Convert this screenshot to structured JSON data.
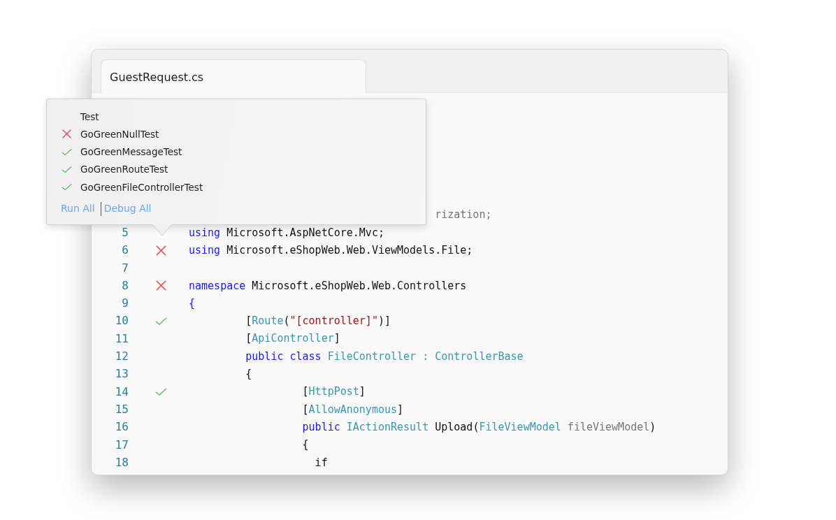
{
  "window": {
    "tab": {
      "label": "GuestRequest.cs",
      "selected": true
    }
  },
  "code_lines": [
    {
      "kind": "cut",
      "tokens": [
        {
          "kind": "comment",
          "text": "rization;"
        }
      ]
    },
    {
      "kind": "top",
      "number": "5",
      "tokens": [
        {
          "kind": "keyword",
          "text": "using"
        },
        {
          "kind": "plain",
          "text": " Microsoft.AspNetCore.Mvc;"
        }
      ]
    },
    {
      "kind": "top",
      "number": "6",
      "test_passed": false,
      "tokens": [
        {
          "kind": "keyword",
          "text": "using"
        },
        {
          "kind": "plain",
          "text": " Microsoft.eShopWeb.Web.ViewModels.File;"
        }
      ]
    },
    {
      "kind": "top",
      "number": "7"
    },
    {
      "kind": "top",
      "number": "8",
      "test_passed": false,
      "tokens": [
        {
          "kind": "keyword",
          "text": "namespace"
        },
        {
          "kind": "plain",
          "text": " Microsoft.eShopWeb.Web.Controllers"
        }
      ]
    },
    {
      "kind": "top",
      "number": "9",
      "tokens": [
        {
          "kind": "keyword",
          "text": "{"
        }
      ]
    },
    {
      "kind": "member",
      "number": "10",
      "test_passed": true,
      "tokens": [
        {
          "kind": "plain",
          "text": "["
        },
        {
          "kind": "type",
          "text": "Route"
        },
        {
          "kind": "plain",
          "text": "("
        },
        {
          "kind": "string",
          "text": "\"[controller]\""
        },
        {
          "kind": "plain",
          "text": ")]"
        }
      ]
    },
    {
      "kind": "member",
      "number": "11",
      "tokens": [
        {
          "kind": "plain",
          "text": "["
        },
        {
          "kind": "type",
          "text": "ApiController"
        },
        {
          "kind": "plain",
          "text": "]"
        }
      ]
    },
    {
      "kind": "member",
      "number": "12",
      "tokens": [
        {
          "kind": "keyword",
          "text": "public class"
        },
        {
          "kind": "type",
          "text": " FileController : ControllerBase"
        }
      ]
    },
    {
      "kind": "member",
      "number": "13",
      "tokens": [
        {
          "kind": "plain",
          "text": "{"
        }
      ]
    },
    {
      "kind": "body",
      "number": "14",
      "test_passed": true,
      "tokens": [
        {
          "kind": "plain",
          "text": "["
        },
        {
          "kind": "type",
          "text": "HttpPost"
        },
        {
          "kind": "plain",
          "text": "]"
        }
      ]
    },
    {
      "kind": "body",
      "number": "15",
      "tokens": [
        {
          "kind": "plain",
          "text": "["
        },
        {
          "kind": "type",
          "text": "AllowAnonymous"
        },
        {
          "kind": "plain",
          "text": "]"
        }
      ]
    },
    {
      "kind": "body",
      "number": "16",
      "tokens": [
        {
          "kind": "keyword",
          "text": "public"
        },
        {
          "kind": "type",
          "text": " IActionResult"
        },
        {
          "kind": "plain",
          "text": " Upload("
        },
        {
          "kind": "type",
          "text": "FileViewModel"
        },
        {
          "kind": "comment",
          "text": " fileViewModel"
        },
        {
          "kind": "plain",
          "text": ")"
        }
      ]
    },
    {
      "kind": "body",
      "number": "17",
      "tokens": [
        {
          "kind": "plain",
          "text": "{"
        }
      ]
    },
    {
      "kind": "statement",
      "number": "18",
      "tokens": [
        {
          "kind": "plain",
          "text": "if"
        }
      ]
    }
  ],
  "test_popup": {
    "header": "Test",
    "tests": [
      {
        "name": "GoGreenNullTest",
        "passed": false
      },
      {
        "name": "GoGreenMessageTest",
        "passed": true
      },
      {
        "name": "GoGreenRouteTest",
        "passed": true
      },
      {
        "name": "GoGreenFileControllerTest",
        "passed": true
      }
    ],
    "actions": [
      "Run All",
      "Debug All"
    ]
  }
}
